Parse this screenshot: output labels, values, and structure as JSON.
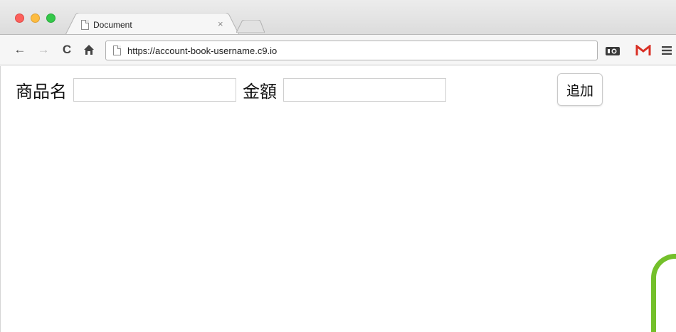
{
  "browser": {
    "tab": {
      "title": "Document",
      "close_glyph": "×"
    },
    "toolbar": {
      "back_glyph": "←",
      "forward_glyph": "→",
      "reload_glyph": "C",
      "home_glyph": "🏠",
      "url": "https://account-book-username.c9.io"
    },
    "extensions": {
      "camera_label": "IO",
      "gmail_label": "M",
      "menu_glyph": "≡"
    }
  },
  "page": {
    "product_label": "商品名",
    "product_value": "",
    "amount_label": "金額",
    "amount_value": "",
    "add_button_label": "追加"
  },
  "colors": {
    "accent_green": "#74c02b",
    "gmail_red": "#d93025",
    "traffic_close": "#fc605c",
    "traffic_min": "#fdbc40",
    "traffic_max": "#34c84a"
  },
  "icons": [
    "document-icon",
    "back-arrow-icon",
    "forward-arrow-icon",
    "reload-icon",
    "home-icon",
    "page-icon",
    "camera-icon",
    "gmail-icon",
    "menu-icon"
  ]
}
